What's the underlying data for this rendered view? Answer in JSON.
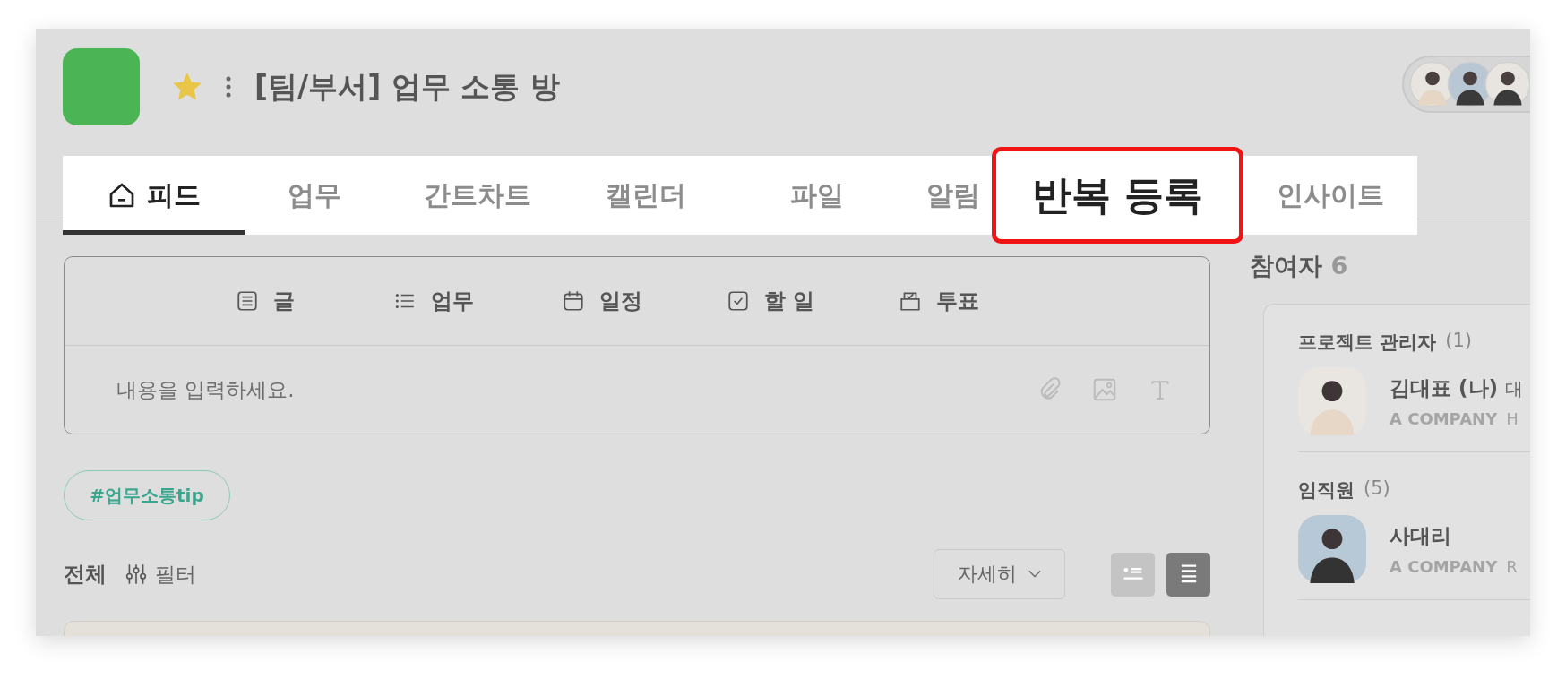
{
  "header": {
    "title": "[팀/부서] 업무 소통 방",
    "favorite": true
  },
  "tabs": [
    {
      "label": "피드",
      "selected": true,
      "highlighted": false,
      "kind": "home"
    },
    {
      "label": "업무",
      "selected": false,
      "highlighted": false
    },
    {
      "label": "간트차트",
      "selected": false,
      "highlighted": false
    },
    {
      "label": "캘린더",
      "selected": false,
      "highlighted": false
    },
    {
      "label": "파일",
      "selected": false,
      "highlighted": false
    },
    {
      "label": "알림",
      "selected": false,
      "highlighted": false
    },
    {
      "label": "반복 등록",
      "selected": false,
      "highlighted": true
    },
    {
      "label": "인사이트",
      "selected": false,
      "highlighted": false
    }
  ],
  "composer": {
    "tools": [
      {
        "kind": "post",
        "label": "글"
      },
      {
        "kind": "task",
        "label": "업무"
      },
      {
        "kind": "schedule",
        "label": "일정"
      },
      {
        "kind": "todo",
        "label": "할 일"
      },
      {
        "kind": "vote",
        "label": "투표"
      }
    ],
    "placeholder": "내용을 입력하세요."
  },
  "tag": "#업무소통tip",
  "feed_bar": {
    "title": "전체",
    "filter": "필터",
    "sort": "자세히",
    "views": [
      {
        "kind": "card",
        "selected": false
      },
      {
        "kind": "list",
        "selected": true
      }
    ]
  },
  "participants": {
    "title": "참여자",
    "count": "6",
    "groups": [
      {
        "title": "프로젝트 관리자",
        "count": "(1)",
        "members": [
          {
            "name": "김대표 (나)",
            "position": "대",
            "company": "A COMPANY",
            "role": "H"
          }
        ]
      },
      {
        "title": "임직원",
        "count": "(5)",
        "members": [
          {
            "name": "사대리",
            "company": "A COMPANY",
            "role": "R"
          }
        ]
      }
    ]
  }
}
